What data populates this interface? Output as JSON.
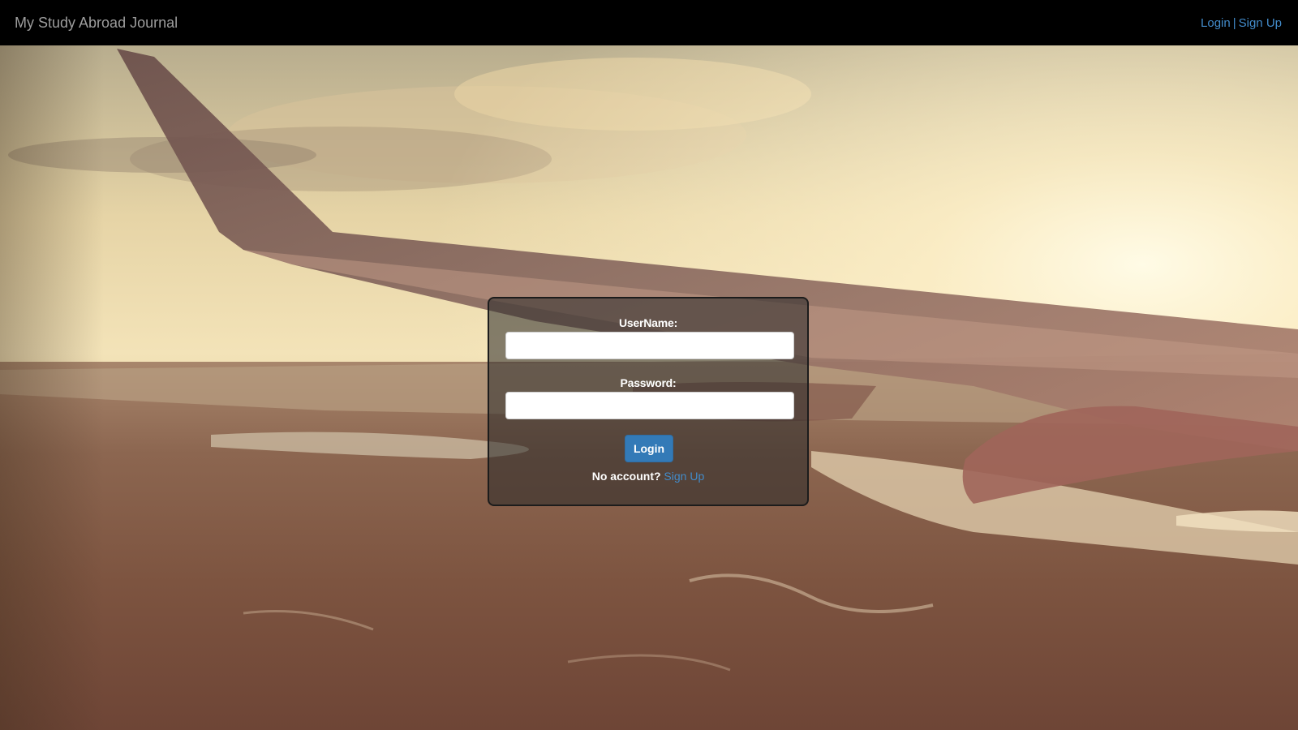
{
  "navbar": {
    "brand": "My Study Abroad Journal",
    "login_link": "Login",
    "separator": "|",
    "signup_link": "Sign Up"
  },
  "login_form": {
    "username_label": "UserName:",
    "username_value": "",
    "password_label": "Password:",
    "password_value": "",
    "login_button": "Login",
    "no_account_text": "No account?",
    "signup_link": "Sign Up"
  },
  "colors": {
    "navbar_bg": "#000000",
    "link": "#428bca",
    "button": "#337ab7"
  }
}
